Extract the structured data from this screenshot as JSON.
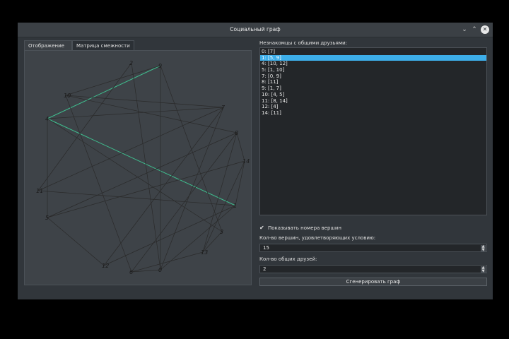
{
  "window": {
    "title": "Социальный граф",
    "controls": {
      "minimize_icon": "chevron-down-icon",
      "maximize_icon": "chevron-up-icon",
      "close_icon": "close-icon"
    }
  },
  "tabs": [
    {
      "label": "Отображение",
      "active": true
    },
    {
      "label": "Матрица смежности",
      "active": false
    }
  ],
  "graph": {
    "nodes": [
      {
        "id": "2"
      },
      {
        "id": "9"
      },
      {
        "id": "10"
      },
      {
        "id": "7"
      },
      {
        "id": "4"
      },
      {
        "id": "8"
      },
      {
        "id": "14"
      },
      {
        "id": "11"
      },
      {
        "id": "1"
      },
      {
        "id": "5"
      },
      {
        "id": "3"
      },
      {
        "id": "13"
      },
      {
        "id": "12"
      },
      {
        "id": "6"
      },
      {
        "id": "0"
      }
    ],
    "edge_color": "#2a2a2a",
    "highlight_color": "#3fbf8f"
  },
  "strangers": {
    "label": "Незнакомцы с общими друзьями:",
    "items": [
      {
        "text": "0: [7]",
        "selected": false
      },
      {
        "text": "1: [5, 9]",
        "selected": true
      },
      {
        "text": "4: [10, 12]",
        "selected": false
      },
      {
        "text": "5: [1, 10]",
        "selected": false
      },
      {
        "text": "7: [0, 9]",
        "selected": false
      },
      {
        "text": "8: [11]",
        "selected": false
      },
      {
        "text": "9: [1, 7]",
        "selected": false
      },
      {
        "text": "10: [4, 5]",
        "selected": false
      },
      {
        "text": "11: [8, 14]",
        "selected": false
      },
      {
        "text": "12: [4]",
        "selected": false
      },
      {
        "text": "14: [11]",
        "selected": false
      }
    ],
    "selection_color": "#3daee9"
  },
  "show_vertex_numbers": {
    "label": "Показывать номера вершин",
    "checked": true
  },
  "vertex_count": {
    "label": "Кол-во вершин, удовлетворяющих условию:",
    "value": "15"
  },
  "common_friends": {
    "label": "Кол-во общих друзей:",
    "value": "2"
  },
  "generate_button": {
    "label": "Сгенерировать граф"
  }
}
